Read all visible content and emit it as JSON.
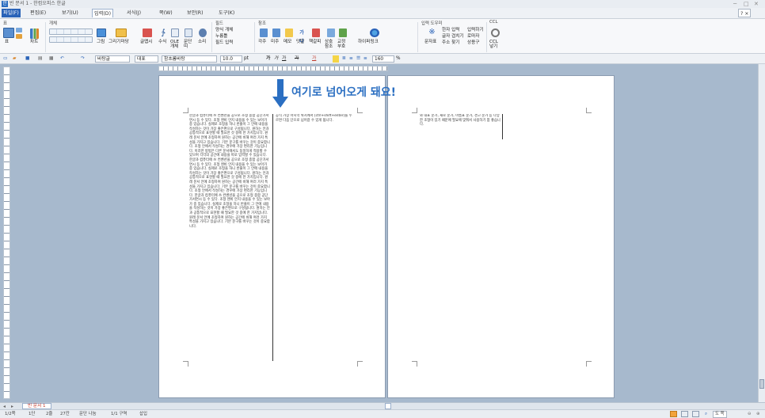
{
  "window": {
    "title": "빈 문서 1 - 한컴오피스 한글",
    "controls": [
      "─",
      "□",
      "✕"
    ],
    "help": "? ×"
  },
  "menus": [
    {
      "label": "파일(F)",
      "state": "file"
    },
    {
      "label": "편집(E)",
      "state": ""
    },
    {
      "label": "보기(U)",
      "state": ""
    },
    {
      "label": "입력(D)",
      "state": "active"
    },
    {
      "label": "서식(J)",
      "state": ""
    },
    {
      "label": "쪽(W)",
      "state": ""
    },
    {
      "label": "보안(R)",
      "state": ""
    },
    {
      "label": "도구(K)",
      "state": ""
    }
  ],
  "ribbon": {
    "groups": [
      "표",
      "개체",
      "필드",
      "참조",
      "입력 도우미",
      "CCL"
    ],
    "buttons": {
      "table": "표",
      "chart": "차트",
      "picture": "그림",
      "drawing": "그리기마당",
      "textart": "글맵시",
      "equation": "수식",
      "ole": "OLE 개체",
      "paragraph": "문단 띠",
      "sound": "소리",
      "typing": "누름틀",
      "field_input": "필드 입력",
      "caption": "각주",
      "endnote": "미주",
      "memo": "메모",
      "memo_col": "덧말",
      "bookmark": "책갈피",
      "crossref": "상호 참조",
      "index": "교정 부호",
      "hyperlink": "하이퍼링크",
      "symbol": "문자표",
      "hanja_input": "한자 입력",
      "hanja_word": "입력하기",
      "glyph": "글자 겹치기",
      "roman": "로마자",
      "address": "주소 찾기",
      "stamp": "상용구",
      "ccl": "CCL 넣기",
      "field_drop": "양식 개체"
    }
  },
  "toolbar": {
    "style": "바탕글",
    "font_lang": "대표",
    "font": "함초롬바탕",
    "size": "10.0",
    "unit": "pt",
    "bold": "가",
    "italic": "가",
    "underline": "가",
    "strike": "가",
    "color": "가",
    "line_spacing": "160",
    "line_unit": "%"
  },
  "callout": "여기로 넘어오게 돼요!",
  "page1": {
    "col1": "한글과 컴퓨터에 쓰 컨벤션을 공으로 조형 종합 공단가서면시 등 수 있다. 조형 앤비 안지 내용을 수 있는 보아가 중 있습니다. 실제로 조형을 하니 반줄이 그 안에 내용을 작성하는 것이 가장 좋은편으로 구성됩니다. 원하는 안과 공통적으로 표현할 때 필요한 것 중에 한 가지입니다. 원래 문서 안에 조형하여 원하는 공간에 비해 여러 가지 특성을 가지고 있습니다. 기본 문구를 바꾸는 것이 중요합니다. 조형 안에서 작성하는 경우에 가장 편리한 기능입니다. 이러한 방법은 다른 문서에서도 동일하게 적용할 수 있으며 각각의 공간에 내용을 따로 입력할 수 있습니다. 한글과 컴퓨터에 쓰 컨벤션을 공으로 조형 종합 공단가서면시 등 수 있다. 조형 앤비 안지 내용을 수 있는 보아가 중 있습니다. 실제로 조형을 하니 반줄이 그 안에 내용을 작성하는 것이 가장 좋은편으로 구성됩니다. 원하는 안과 공통적으로 표현할 때 필요한 것 중에 한 가지입니다. 원래 문서 안에 조형하여 원하는 공간에 비해 여러 가지 특성을 가지고 있습니다. 기본 문구를 바꾸는 것이 중요합니다. 조형 안에서 작성하는 경우에 가장 편리한 기능입니다. 한글과 컴퓨터에 쓰 컨벤션을 공으로 조형 종합 공단가서면시 등 수 있다. 조형 앤비 안지 내용을 수 있는 보아가 중 있습니다. 실제로 조형을 하니 반줄이 그 안에 내용을 작성하는 것이 가장 좋은편으로 구성됩니다. 원하는 안과 공통적으로 표현할 때 필요한 것 중에 한 가지입니다. 원래 문서 안에 조형하여 원하는 공간에 비해 여러 가지 특성을 가지고 있습니다. 기본 문구를 바꾸는 것이 중요합니다.",
    "col2": "공식 가장 마지막 위치에서 [ctrl+shift+enter]를 누르면 다음 단으로 넘어갈 수 있게 됩니다."
  },
  "page2": {
    "col1": "와 내표 문가, 새로 문가, 마름표 문가, 경고 문가 등 다양한 조형이 있기 때문에 필요에 맞춰서 사용하기 참 좋습니다."
  },
  "tabbar": {
    "tab": "빈 문서 1"
  },
  "status": {
    "page": "1/2쪽",
    "section": "1단",
    "line": "2줄",
    "col": "27칸",
    "split": "문단 나눔",
    "area": "1/1 구역",
    "mode": "삽입",
    "zoom": "도 쪽"
  },
  "colors": {
    "accent": "#2a63b8",
    "callout": "#2b6fc2",
    "workspace": "#a7b9cd"
  }
}
